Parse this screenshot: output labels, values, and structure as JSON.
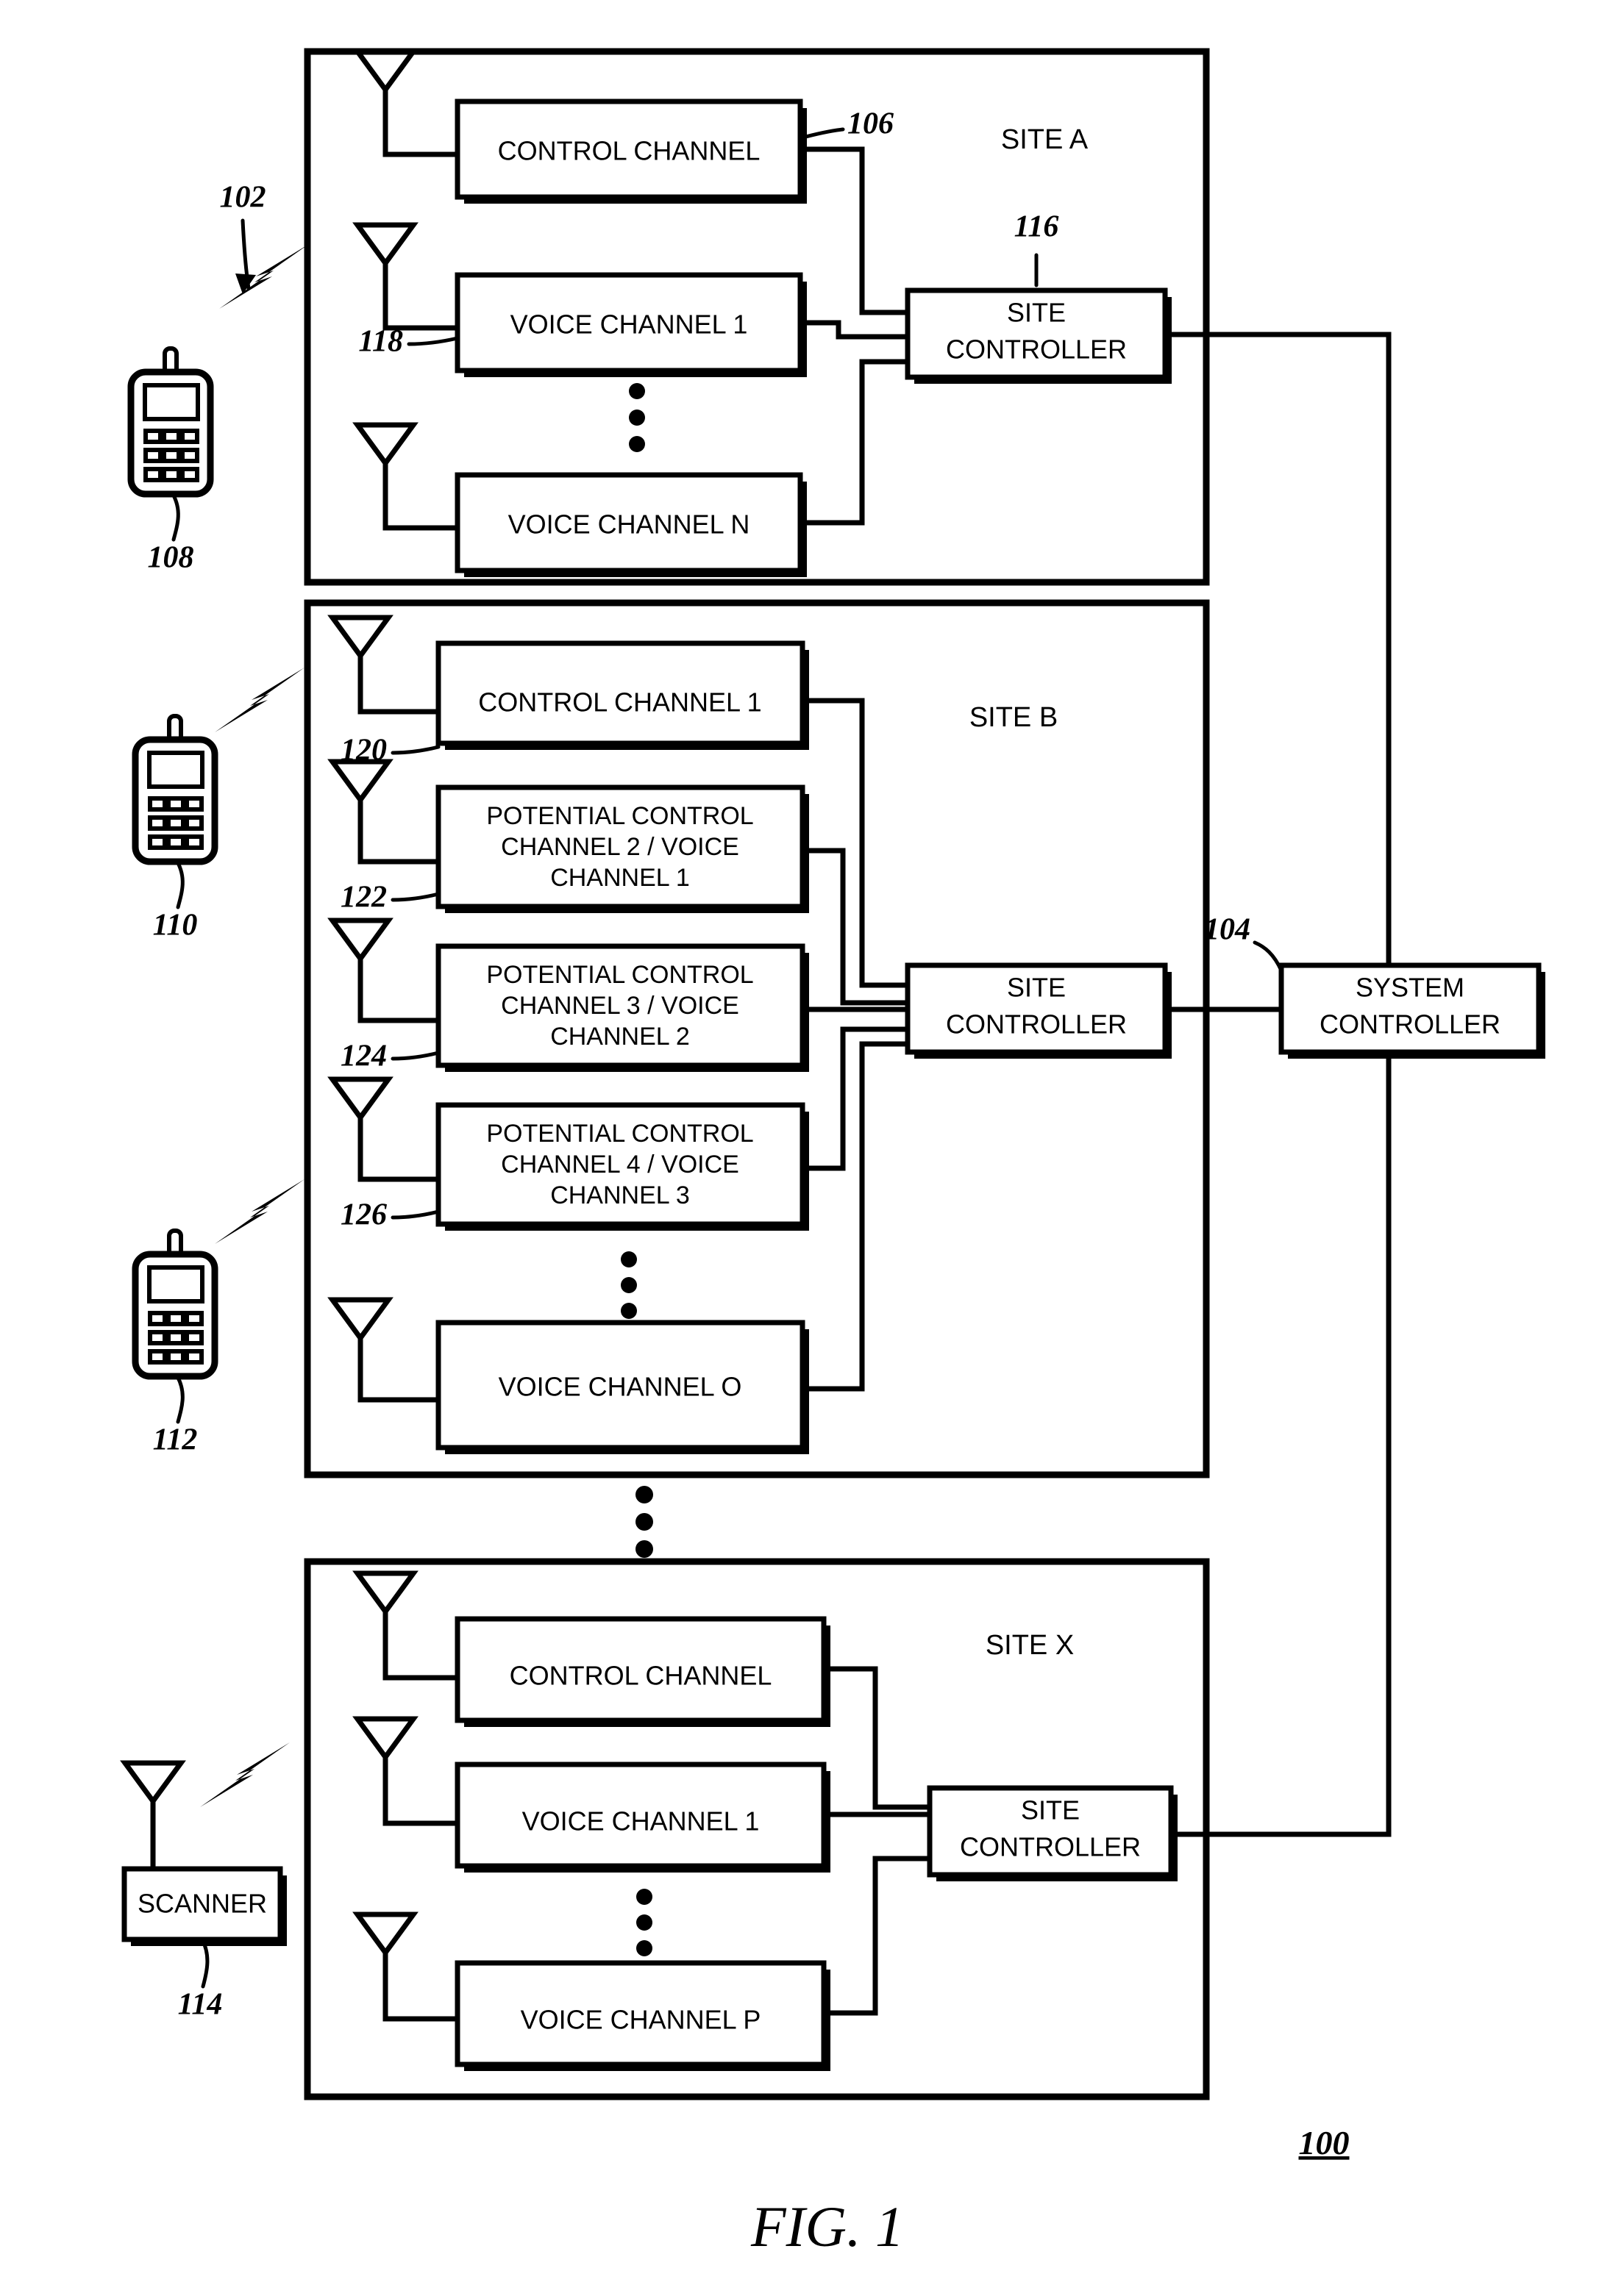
{
  "figure": {
    "caption": "FIG. 1",
    "system_ref": "100"
  },
  "system": {
    "controller_label_line1": "SYSTEM",
    "controller_label_line2": "CONTROLLER",
    "controller_ref": "104"
  },
  "rf_link": {
    "ref": "102"
  },
  "subscribers": [
    {
      "name": "mobile-radio-1",
      "ref": "108"
    },
    {
      "name": "mobile-radio-2",
      "ref": "110"
    },
    {
      "name": "mobile-radio-3",
      "ref": "112"
    }
  ],
  "scanner": {
    "label": "SCANNER",
    "ref": "114"
  },
  "sites": [
    {
      "id": "site-a",
      "title": "SITE A",
      "controller": {
        "line1": "SITE",
        "line2": "CONTROLLER",
        "ref": "116"
      },
      "channels": [
        {
          "lines": [
            "CONTROL CHANNEL"
          ],
          "ref": "106",
          "ref_side": "right"
        },
        {
          "lines": [
            "VOICE CHANNEL 1"
          ],
          "ref": "118",
          "ref_side": "left"
        },
        {
          "lines": [
            "VOICE CHANNEL N"
          ],
          "ref": "",
          "ref_side": ""
        }
      ],
      "ellipsis_after_index": 1
    },
    {
      "id": "site-b",
      "title": "SITE B",
      "controller": {
        "line1": "SITE",
        "line2": "CONTROLLER",
        "ref": ""
      },
      "channels": [
        {
          "lines": [
            "CONTROL CHANNEL 1"
          ],
          "ref": "120",
          "ref_side": "left"
        },
        {
          "lines": [
            "POTENTIAL CONTROL",
            "CHANNEL 2 / VOICE",
            "CHANNEL 1"
          ],
          "ref": "122",
          "ref_side": "left"
        },
        {
          "lines": [
            "POTENTIAL CONTROL",
            "CHANNEL 3 / VOICE",
            "CHANNEL 2"
          ],
          "ref": "124",
          "ref_side": "left"
        },
        {
          "lines": [
            "POTENTIAL CONTROL",
            "CHANNEL 4 / VOICE",
            "CHANNEL 3"
          ],
          "ref": "126",
          "ref_side": "left"
        },
        {
          "lines": [
            "VOICE CHANNEL O"
          ],
          "ref": "",
          "ref_side": ""
        }
      ],
      "ellipsis_after_index": 3
    },
    {
      "id": "site-x",
      "title": "SITE  X",
      "controller": {
        "line1": "SITE",
        "line2": "CONTROLLER",
        "ref": ""
      },
      "channels": [
        {
          "lines": [
            "CONTROL CHANNEL"
          ],
          "ref": "",
          "ref_side": ""
        },
        {
          "lines": [
            "VOICE CHANNEL 1"
          ],
          "ref": "",
          "ref_side": ""
        },
        {
          "lines": [
            "VOICE CHANNEL P"
          ],
          "ref": "",
          "ref_side": ""
        }
      ],
      "ellipsis_after_index": 1
    }
  ],
  "colors": {
    "ink": "#000000",
    "paper": "#ffffff"
  }
}
